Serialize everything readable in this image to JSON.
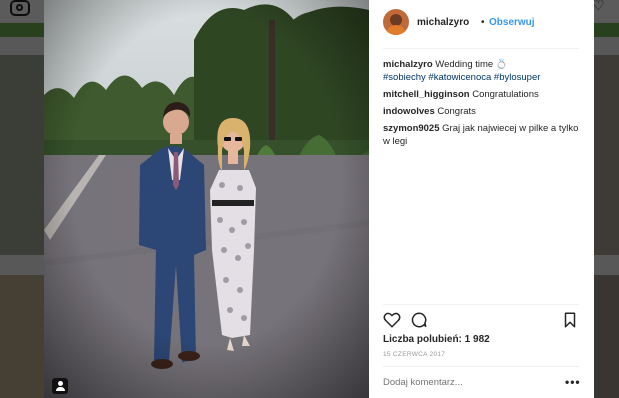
{
  "post": {
    "username": "michalzyro",
    "separator": "•",
    "follow_label": "Obserwuj",
    "likes_text": "Liczba polubień: 1 982",
    "date": "15 CZERWCA 2017",
    "comment_placeholder": "Dodaj komentarz...",
    "more_label": "•••"
  },
  "caption": {
    "username": "michalzyro",
    "text": "Wedding time 💍",
    "hashtags": [
      "#sobiechy",
      "#katowicenoca",
      "#bylosuper"
    ]
  },
  "comments": [
    {
      "username": "mitchell_higginson",
      "text": "Congratulations"
    },
    {
      "username": "indowolves",
      "text": "Congrats"
    },
    {
      "username": "szymon9025",
      "text": "Graj jak najwiecej w pilke a tylko w legi"
    }
  ],
  "icons": {
    "like": "heart-icon",
    "comment": "comment-icon",
    "save": "bookmark-icon",
    "tag": "user-tag-icon",
    "logo": "instagram-logo-icon"
  }
}
